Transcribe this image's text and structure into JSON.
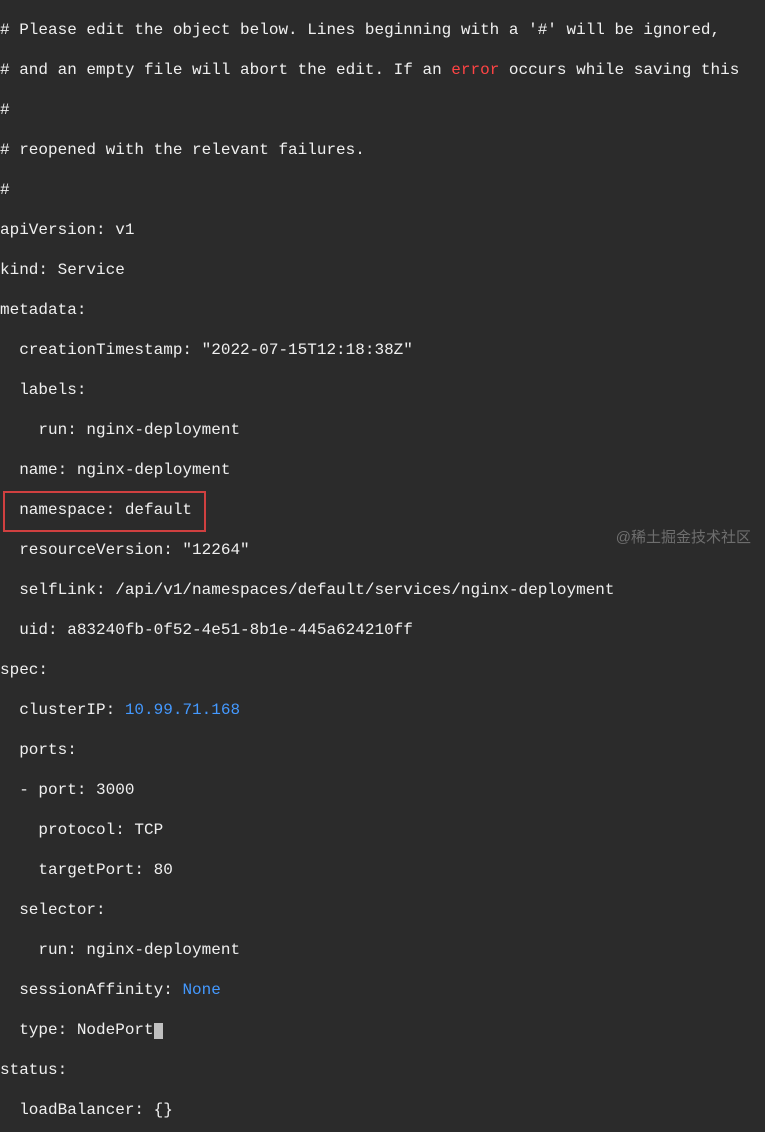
{
  "comments": {
    "line1": "# Please edit the object below. Lines beginning with a '#' will be ignored,",
    "line2_pre": "# and an empty file will abort the edit. If an ",
    "line2_error": "error",
    "line2_post": " occurs while saving this",
    "line3": "#",
    "line4": "# reopened with the relevant failures.",
    "line5": "#"
  },
  "yaml": {
    "apiVersion": "apiVersion: v1",
    "kind": "kind: Service",
    "metadata": "metadata:",
    "creationTimestamp": "  creationTimestamp: \"2022-07-15T12:18:38Z\"",
    "labels": "  labels:",
    "labels_run": "    run: nginx-deployment",
    "name": "  name: nginx-deployment",
    "namespace": "  namespace: default",
    "resourceVersion": "  resourceVersion: \"12264\"",
    "selfLink": "  selfLink: /api/v1/namespaces/default/services/nginx-deployment",
    "uid": "  uid: a83240fb-0f52-4e51-8b1e-445a624210ff",
    "spec": "spec:",
    "clusterIP_key": "  clusterIP: ",
    "clusterIP_val": "10.99.71.168",
    "ports": "  ports:",
    "port": "  - port: 3000",
    "protocol": "    protocol: TCP",
    "targetPort": "    targetPort: 80",
    "selector": "  selector:",
    "selector_run": "    run: nginx-deployment",
    "sessionAffinity_key": "  sessionAffinity: ",
    "sessionAffinity_val": "None",
    "type": "  type: NodePort",
    "status": "status:",
    "loadBalancer": "  loadBalancer: {}"
  },
  "watermark": "@稀土掘金技术社区"
}
